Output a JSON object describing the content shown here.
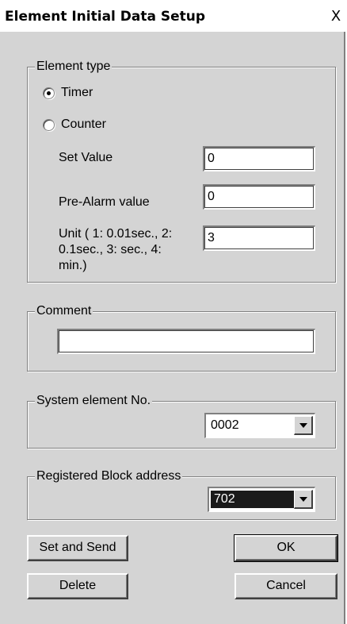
{
  "window": {
    "title": "Element Initial Data Setup",
    "close_glyph": "X"
  },
  "element_type": {
    "legend": "Element type",
    "options": [
      {
        "label": "Timer",
        "checked": true
      },
      {
        "label": "Counter",
        "checked": false
      }
    ],
    "set_value_label": "Set Value",
    "set_value": "0",
    "pre_alarm_label": "Pre-Alarm value",
    "pre_alarm_value": "0",
    "unit_label_1": "Unit ( 1: 0.01sec., 2:",
    "unit_label_2": "0.1sec., 3: sec., 4:",
    "unit_label_3": "min.)",
    "unit_value": "3"
  },
  "comment": {
    "legend": "Comment",
    "value": ""
  },
  "system_element": {
    "legend": "System element No.",
    "value": "0002"
  },
  "registered_block": {
    "legend": "Registered Block address",
    "value": "702"
  },
  "buttons": {
    "set_and_send": "Set and Send",
    "ok": "OK",
    "delete": "Delete",
    "cancel": "Cancel"
  }
}
